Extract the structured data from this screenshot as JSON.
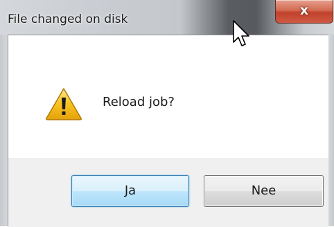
{
  "window": {
    "title": "File changed on disk",
    "close_symbol": "x",
    "close_icon": "close-icon"
  },
  "dialog": {
    "icon": "warning-icon",
    "message": "Reload job?"
  },
  "buttons": {
    "yes_label": "Ja",
    "no_label": "Nee"
  },
  "colors": {
    "close_button": "#c7503b",
    "default_button_border": "#3c7fb1",
    "warning_fill": "#f5c518",
    "button_bar": "#f0f0f0"
  }
}
